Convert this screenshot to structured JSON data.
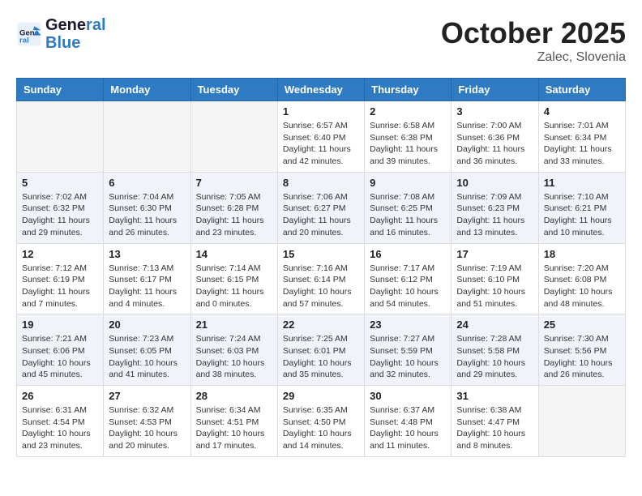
{
  "header": {
    "logo_line1": "General",
    "logo_line2": "Blue",
    "month": "October 2025",
    "location": "Zalec, Slovenia"
  },
  "days_of_week": [
    "Sunday",
    "Monday",
    "Tuesday",
    "Wednesday",
    "Thursday",
    "Friday",
    "Saturday"
  ],
  "weeks": [
    [
      {
        "day": "",
        "info": ""
      },
      {
        "day": "",
        "info": ""
      },
      {
        "day": "",
        "info": ""
      },
      {
        "day": "1",
        "info": "Sunrise: 6:57 AM\nSunset: 6:40 PM\nDaylight: 11 hours and 42 minutes."
      },
      {
        "day": "2",
        "info": "Sunrise: 6:58 AM\nSunset: 6:38 PM\nDaylight: 11 hours and 39 minutes."
      },
      {
        "day": "3",
        "info": "Sunrise: 7:00 AM\nSunset: 6:36 PM\nDaylight: 11 hours and 36 minutes."
      },
      {
        "day": "4",
        "info": "Sunrise: 7:01 AM\nSunset: 6:34 PM\nDaylight: 11 hours and 33 minutes."
      }
    ],
    [
      {
        "day": "5",
        "info": "Sunrise: 7:02 AM\nSunset: 6:32 PM\nDaylight: 11 hours and 29 minutes."
      },
      {
        "day": "6",
        "info": "Sunrise: 7:04 AM\nSunset: 6:30 PM\nDaylight: 11 hours and 26 minutes."
      },
      {
        "day": "7",
        "info": "Sunrise: 7:05 AM\nSunset: 6:28 PM\nDaylight: 11 hours and 23 minutes."
      },
      {
        "day": "8",
        "info": "Sunrise: 7:06 AM\nSunset: 6:27 PM\nDaylight: 11 hours and 20 minutes."
      },
      {
        "day": "9",
        "info": "Sunrise: 7:08 AM\nSunset: 6:25 PM\nDaylight: 11 hours and 16 minutes."
      },
      {
        "day": "10",
        "info": "Sunrise: 7:09 AM\nSunset: 6:23 PM\nDaylight: 11 hours and 13 minutes."
      },
      {
        "day": "11",
        "info": "Sunrise: 7:10 AM\nSunset: 6:21 PM\nDaylight: 11 hours and 10 minutes."
      }
    ],
    [
      {
        "day": "12",
        "info": "Sunrise: 7:12 AM\nSunset: 6:19 PM\nDaylight: 11 hours and 7 minutes."
      },
      {
        "day": "13",
        "info": "Sunrise: 7:13 AM\nSunset: 6:17 PM\nDaylight: 11 hours and 4 minutes."
      },
      {
        "day": "14",
        "info": "Sunrise: 7:14 AM\nSunset: 6:15 PM\nDaylight: 11 hours and 0 minutes."
      },
      {
        "day": "15",
        "info": "Sunrise: 7:16 AM\nSunset: 6:14 PM\nDaylight: 10 hours and 57 minutes."
      },
      {
        "day": "16",
        "info": "Sunrise: 7:17 AM\nSunset: 6:12 PM\nDaylight: 10 hours and 54 minutes."
      },
      {
        "day": "17",
        "info": "Sunrise: 7:19 AM\nSunset: 6:10 PM\nDaylight: 10 hours and 51 minutes."
      },
      {
        "day": "18",
        "info": "Sunrise: 7:20 AM\nSunset: 6:08 PM\nDaylight: 10 hours and 48 minutes."
      }
    ],
    [
      {
        "day": "19",
        "info": "Sunrise: 7:21 AM\nSunset: 6:06 PM\nDaylight: 10 hours and 45 minutes."
      },
      {
        "day": "20",
        "info": "Sunrise: 7:23 AM\nSunset: 6:05 PM\nDaylight: 10 hours and 41 minutes."
      },
      {
        "day": "21",
        "info": "Sunrise: 7:24 AM\nSunset: 6:03 PM\nDaylight: 10 hours and 38 minutes."
      },
      {
        "day": "22",
        "info": "Sunrise: 7:25 AM\nSunset: 6:01 PM\nDaylight: 10 hours and 35 minutes."
      },
      {
        "day": "23",
        "info": "Sunrise: 7:27 AM\nSunset: 5:59 PM\nDaylight: 10 hours and 32 minutes."
      },
      {
        "day": "24",
        "info": "Sunrise: 7:28 AM\nSunset: 5:58 PM\nDaylight: 10 hours and 29 minutes."
      },
      {
        "day": "25",
        "info": "Sunrise: 7:30 AM\nSunset: 5:56 PM\nDaylight: 10 hours and 26 minutes."
      }
    ],
    [
      {
        "day": "26",
        "info": "Sunrise: 6:31 AM\nSunset: 4:54 PM\nDaylight: 10 hours and 23 minutes."
      },
      {
        "day": "27",
        "info": "Sunrise: 6:32 AM\nSunset: 4:53 PM\nDaylight: 10 hours and 20 minutes."
      },
      {
        "day": "28",
        "info": "Sunrise: 6:34 AM\nSunset: 4:51 PM\nDaylight: 10 hours and 17 minutes."
      },
      {
        "day": "29",
        "info": "Sunrise: 6:35 AM\nSunset: 4:50 PM\nDaylight: 10 hours and 14 minutes."
      },
      {
        "day": "30",
        "info": "Sunrise: 6:37 AM\nSunset: 4:48 PM\nDaylight: 10 hours and 11 minutes."
      },
      {
        "day": "31",
        "info": "Sunrise: 6:38 AM\nSunset: 4:47 PM\nDaylight: 10 hours and 8 minutes."
      },
      {
        "day": "",
        "info": ""
      }
    ]
  ]
}
